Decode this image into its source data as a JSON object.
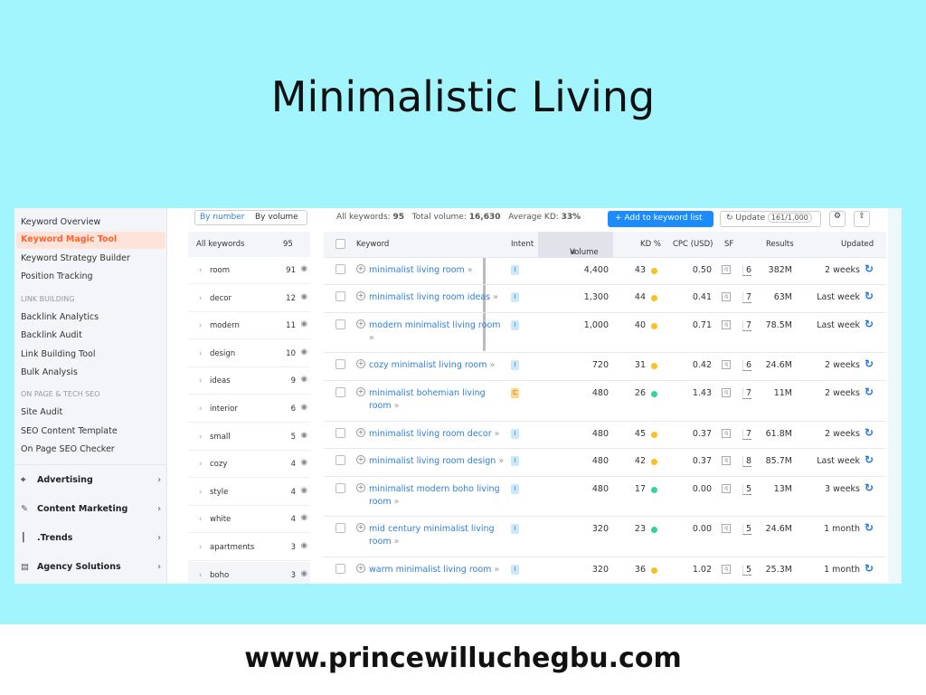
{
  "title": "Minimalistic Living",
  "footer": "www.princewilluchegbu.com",
  "sidebar": {
    "items": [
      "Keyword Overview",
      "Keyword Magic Tool",
      "Keyword Strategy Builder",
      "Position Tracking"
    ],
    "active": "Keyword Magic Tool",
    "sections": [
      {
        "heading": "LINK BUILDING",
        "items": [
          "Backlink Analytics",
          "Backlink Audit",
          "Link Building Tool",
          "Bulk Analysis"
        ]
      },
      {
        "heading": "ON PAGE & TECH SEO",
        "items": [
          "Site Audit",
          "SEO Content Template",
          "On Page SEO Checker"
        ]
      }
    ],
    "groups": [
      {
        "label": "Advertising",
        "icon": "crosshair-icon"
      },
      {
        "label": "Content Marketing",
        "icon": "pen-icon"
      },
      {
        "label": ".Trends",
        "icon": "bar-chart-icon"
      },
      {
        "label": "Agency Solutions",
        "icon": "document-icon"
      }
    ]
  },
  "groups_panel": {
    "tabs": [
      "By number",
      "By volume"
    ],
    "all_label": "All keywords",
    "all_count": "95",
    "items": [
      {
        "label": "room",
        "count": "91"
      },
      {
        "label": "decor",
        "count": "12"
      },
      {
        "label": "modern",
        "count": "11"
      },
      {
        "label": "design",
        "count": "10"
      },
      {
        "label": "ideas",
        "count": "9"
      },
      {
        "label": "interior",
        "count": "6"
      },
      {
        "label": "small",
        "count": "5"
      },
      {
        "label": "cozy",
        "count": "4"
      },
      {
        "label": "style",
        "count": "4"
      },
      {
        "label": "white",
        "count": "4"
      },
      {
        "label": "apartments",
        "count": "3"
      },
      {
        "label": "boho",
        "count": "3"
      }
    ]
  },
  "toolbar": {
    "summary_label1": "All keywords:",
    "summary_val1": "95",
    "summary_label2": "Total volume:",
    "summary_val2": "16,630",
    "summary_label3": "Average KD:",
    "summary_val3": "33%",
    "add_button": "+ Add to keyword list",
    "update_button": "Update",
    "update_count": "161/1,000"
  },
  "table": {
    "columns": [
      "Keyword",
      "Intent",
      "Volume",
      "KD %",
      "CPC (USD)",
      "SF",
      "Results",
      "Updated"
    ],
    "rows": [
      {
        "keyword": "minimalist living room",
        "intent": "I",
        "volume": "4,400",
        "kd": "43",
        "kd_color": "#fbbf24",
        "cpc": "0.50",
        "sf": "6",
        "results": "382M",
        "updated": "2 weeks"
      },
      {
        "keyword": "minimalist living room ideas",
        "intent": "I",
        "volume": "1,300",
        "kd": "44",
        "kd_color": "#fbbf24",
        "cpc": "0.41",
        "sf": "7",
        "results": "63M",
        "updated": "Last week"
      },
      {
        "keyword": "modern minimalist living room",
        "intent": "I",
        "volume": "1,000",
        "kd": "40",
        "kd_color": "#fbbf24",
        "cpc": "0.71",
        "sf": "7",
        "results": "78.5M",
        "updated": "Last week"
      },
      {
        "keyword": "cozy minimalist living room",
        "intent": "I",
        "volume": "720",
        "kd": "31",
        "kd_color": "#fbbf24",
        "cpc": "0.42",
        "sf": "6",
        "results": "24.6M",
        "updated": "2 weeks"
      },
      {
        "keyword": "minimalist bohemian living room",
        "intent": "C",
        "volume": "480",
        "kd": "26",
        "kd_color": "#34d399",
        "cpc": "1.43",
        "sf": "7",
        "results": "11M",
        "updated": "2 weeks"
      },
      {
        "keyword": "minimalist living room decor",
        "intent": "I",
        "volume": "480",
        "kd": "45",
        "kd_color": "#fbbf24",
        "cpc": "0.37",
        "sf": "7",
        "results": "61.8M",
        "updated": "2 weeks"
      },
      {
        "keyword": "minimalist living room design",
        "intent": "I",
        "volume": "480",
        "kd": "42",
        "kd_color": "#fbbf24",
        "cpc": "0.37",
        "sf": "8",
        "results": "85.7M",
        "updated": "Last week"
      },
      {
        "keyword": "minimalist modern boho living room",
        "intent": "I",
        "volume": "480",
        "kd": "17",
        "kd_color": "#34d399",
        "cpc": "0.00",
        "sf": "5",
        "results": "13M",
        "updated": "3 weeks"
      },
      {
        "keyword": "mid century minimalist living room",
        "intent": "I",
        "volume": "320",
        "kd": "23",
        "kd_color": "#34d399",
        "cpc": "0.00",
        "sf": "5",
        "results": "24.6M",
        "updated": "1 month"
      },
      {
        "keyword": "warm minimalist living room",
        "intent": "I",
        "volume": "320",
        "kd": "36",
        "kd_color": "#fbbf24",
        "cpc": "1.02",
        "sf": "5",
        "results": "25.3M",
        "updated": "1 month"
      }
    ]
  },
  "colors": {
    "background": "#a2f5fd",
    "accent": "#ff642d",
    "link": "#2f7fd6",
    "primary_button": "#1a8cff"
  }
}
